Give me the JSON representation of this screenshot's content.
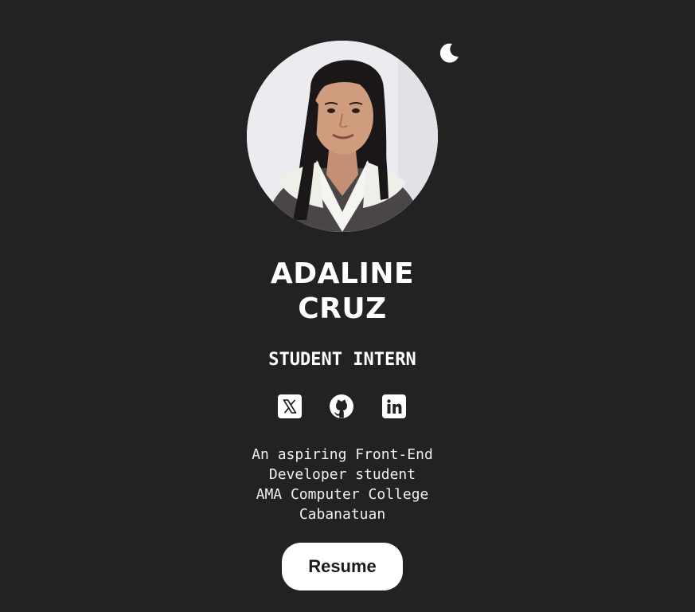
{
  "theme_toggle": {
    "icon": "moon-icon"
  },
  "profile": {
    "avatar_icon": "profile-photo",
    "name_line1": "ADALINE",
    "name_line2": "CRUZ",
    "role": "STUDENT INTERN"
  },
  "socials": [
    {
      "icon": "x-twitter-icon"
    },
    {
      "icon": "github-icon"
    },
    {
      "icon": "linkedin-icon"
    }
  ],
  "bio": {
    "line1": "An aspiring Front-End",
    "line2": "Developer student",
    "line3": "AMA Computer College",
    "line4": "Cabanatuan"
  },
  "resume_button": {
    "label": "Resume"
  },
  "colors": {
    "background": "#222222",
    "text": "#ffffff",
    "button_bg": "#ffffff",
    "button_text": "#1b1b1b"
  }
}
